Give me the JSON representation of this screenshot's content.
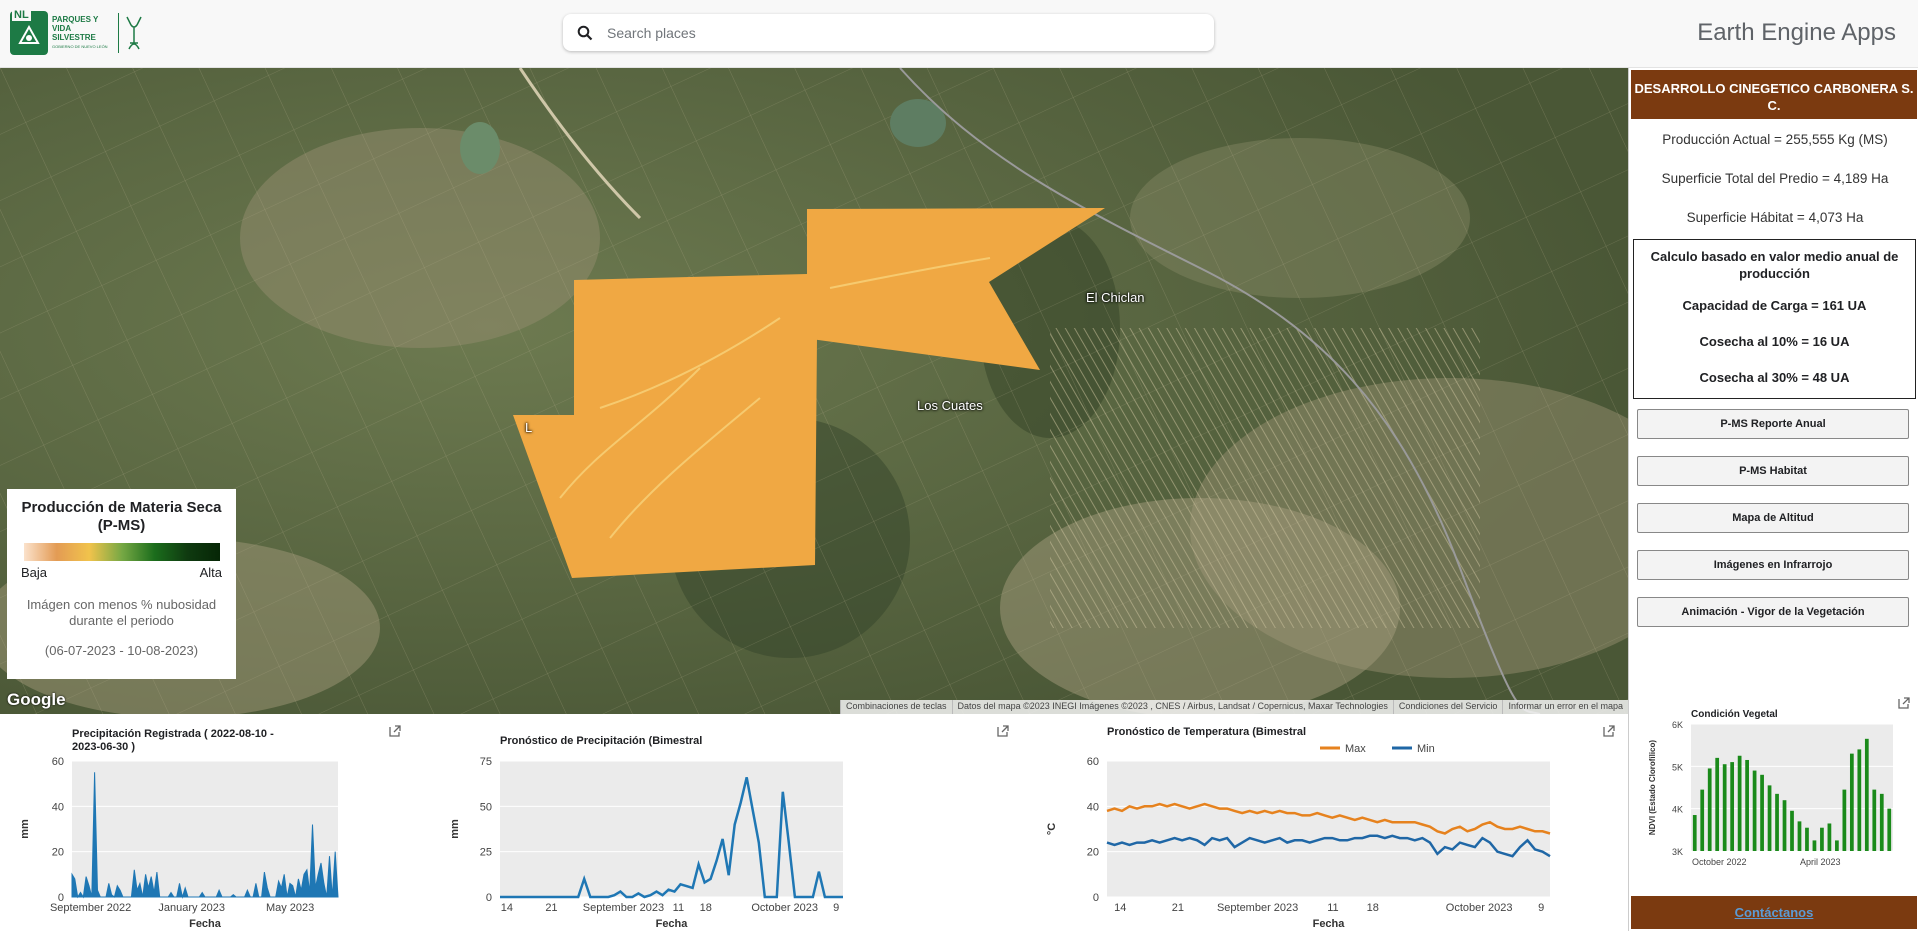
{
  "header": {
    "logo_abbr": "NL",
    "logo_line1": "PARQUES Y",
    "logo_line2": "VIDA SILVESTRE",
    "logo_sub": "GOBIERNO DE NUEVO LEÓN",
    "search_placeholder": "Search places",
    "app_title": "Earth Engine Apps"
  },
  "map": {
    "places": [
      "El Chiclan",
      "Los Cuates",
      "L"
    ],
    "google": "Google",
    "attribution": [
      "Combinaciones de teclas",
      "Datos del mapa ©2023 INEGI Imágenes ©2023 , CNES / Airbus, Landsat / Copernicus, Maxar Technologies",
      "Condiciones del Servicio",
      "Informar un error en el mapa"
    ],
    "overlay_color": "#f0a843"
  },
  "legend": {
    "title": "Producción de Materia Seca (P-MS)",
    "low": "Baja",
    "high": "Alta",
    "note": "Imágen con menos % nubosidad durante el periodo",
    "period": "(06-07-2023 - 10-08-2023)"
  },
  "panel": {
    "header": "DESARROLLO CINEGETICO CARBONERA S. C.",
    "produccion": "Producción Actual = 255,555 Kg (MS)",
    "superficie_total": "Superficie Total del Predio = 4,189 Ha",
    "superficie_habitat": "Superficie Hábitat = 4,073 Ha",
    "calc_title": "Calculo basado en valor medio anual de producción",
    "capacidad": "Capacidad de Carga = 161 UA",
    "cosecha10": "Cosecha al 10% = 16 UA",
    "cosecha30": "Cosecha al 30% = 48 UA",
    "buttons": [
      "P-MS Reporte Anual",
      "P-MS Habitat",
      "Mapa de Altitud",
      "Imágenes en Infrarrojo",
      "Animación - Vigor de la Vegetación"
    ],
    "contact": "Contáctanos"
  },
  "chart_data": [
    {
      "type": "area",
      "title": "Precipitación Registrada ( 2022-08-10 - 2023-06-30 )",
      "xlabel": "Fecha",
      "ylabel": "mm",
      "ylim": [
        0,
        60
      ],
      "yticks": [
        0,
        20,
        40,
        60
      ],
      "xticks": [
        "September 2022",
        "January 2023",
        "May 2023"
      ],
      "color": "#1f77b4",
      "values": [
        10,
        8,
        0,
        2,
        0,
        9,
        5,
        0,
        55,
        3,
        0,
        0,
        0,
        6,
        1,
        0,
        5,
        3,
        0,
        0,
        0,
        0,
        12,
        3,
        6,
        0,
        10,
        4,
        9,
        2,
        11,
        0,
        0,
        0,
        0,
        2,
        0,
        0,
        6,
        0,
        4,
        0,
        0,
        0,
        0,
        0,
        2,
        0,
        0,
        0,
        0,
        0,
        3,
        0,
        0,
        0,
        0,
        1,
        0,
        0,
        0,
        0,
        3,
        0,
        0,
        6,
        0,
        0,
        11,
        4,
        0,
        0,
        0,
        7,
        4,
        10,
        0,
        6,
        5,
        0,
        8,
        3,
        10,
        12,
        2,
        32,
        4,
        10,
        15,
        6,
        0,
        18,
        0,
        20,
        0
      ]
    },
    {
      "type": "line",
      "title": "Pronóstico de Precipitación (Bimestral",
      "xlabel": "Fecha",
      "ylabel": "mm",
      "ylim": [
        0,
        75
      ],
      "yticks": [
        0,
        25,
        50,
        75
      ],
      "xticks": [
        "14",
        "21",
        "September 2023",
        "11",
        "18",
        "October 2023",
        "9"
      ],
      "color": "#1f77b4",
      "values": [
        0,
        0,
        0,
        0,
        0,
        0,
        0,
        0,
        0,
        0,
        0,
        0,
        0,
        0,
        10,
        0,
        0,
        0,
        0,
        1,
        3,
        0,
        0,
        2,
        0,
        1,
        3,
        1,
        4,
        3,
        7,
        6,
        5,
        18,
        8,
        10,
        20,
        32,
        12,
        40,
        52,
        66,
        48,
        30,
        0,
        0,
        0,
        58,
        30,
        0,
        0,
        0,
        0,
        14,
        0,
        0,
        0,
        0
      ]
    },
    {
      "type": "line",
      "title": "Pronóstico de Temperatura (Bimestral",
      "xlabel": "Fecha",
      "ylabel": "°C",
      "ylim": [
        0,
        60
      ],
      "yticks": [
        0,
        20,
        40,
        60
      ],
      "xticks": [
        "14",
        "21",
        "September 2023",
        "11",
        "18",
        "October 2023",
        "9"
      ],
      "series": [
        {
          "name": "Max",
          "color": "#e6821e",
          "values": [
            38,
            39,
            38,
            40,
            39,
            40,
            40,
            41,
            40,
            41,
            40,
            39,
            40,
            41,
            40,
            39,
            39,
            38,
            37,
            38,
            37,
            38,
            37,
            38,
            37,
            37,
            36,
            36,
            37,
            36,
            35,
            36,
            35,
            34,
            35,
            34,
            33,
            34,
            33,
            33,
            33,
            33,
            32,
            31,
            29,
            28,
            30,
            31,
            29,
            30,
            32,
            33,
            31,
            30,
            30,
            31,
            30,
            29,
            29,
            28
          ]
        },
        {
          "name": "Min",
          "color": "#1f67a6",
          "values": [
            24,
            23,
            24,
            23,
            24,
            24,
            25,
            24,
            25,
            26,
            25,
            26,
            25,
            23,
            26,
            25,
            26,
            22,
            24,
            26,
            25,
            24,
            25,
            26,
            24,
            25,
            25,
            24,
            25,
            26,
            26,
            25,
            25,
            26,
            26,
            27,
            27,
            26,
            27,
            26,
            26,
            25,
            26,
            24,
            19,
            22,
            21,
            24,
            23,
            22,
            26,
            24,
            20,
            19,
            18,
            22,
            25,
            21,
            20,
            18
          ]
        }
      ]
    },
    {
      "type": "bar",
      "title": "Condición Vegetal",
      "xlabel": "",
      "ylabel": "NDVI (Estado Clorofílico)",
      "ylim": [
        3000,
        6000
      ],
      "yticks": [
        "3K",
        "4K",
        "5K",
        "6K"
      ],
      "xticks": [
        "October 2022",
        "April 2023"
      ],
      "color": "#1a8a1a",
      "values": [
        3850,
        4450,
        4950,
        5200,
        5050,
        5100,
        5250,
        5150,
        4900,
        4800,
        4550,
        4350,
        4200,
        3950,
        3700,
        3550,
        3250,
        3550,
        3650,
        3250,
        4450,
        5300,
        5400,
        5650,
        4450,
        4350,
        4000
      ]
    }
  ]
}
